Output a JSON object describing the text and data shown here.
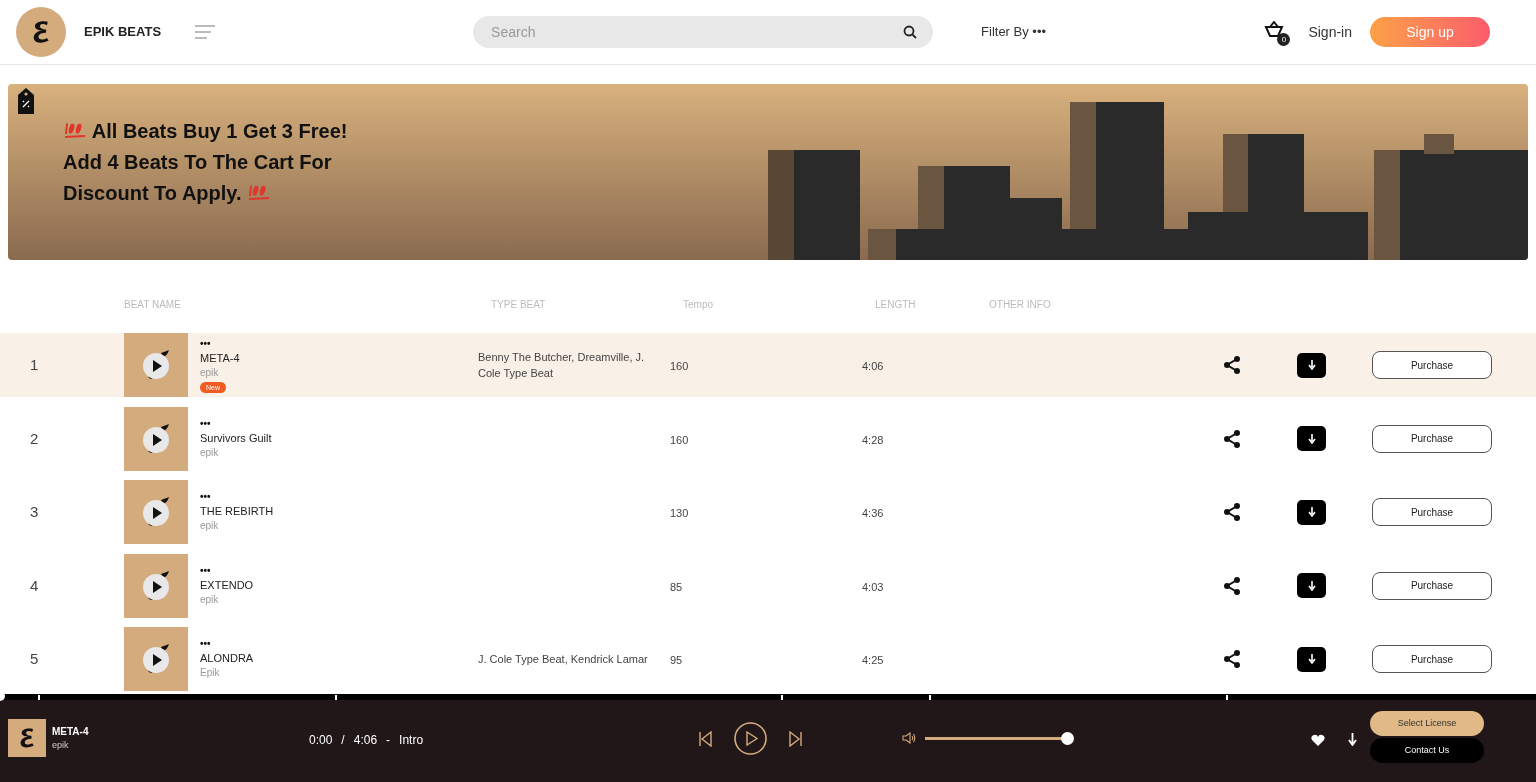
{
  "header": {
    "brand": "EPIK BEATS",
    "search": {
      "placeholder": "Search"
    },
    "filter": "Filter By •••",
    "cart_count": "0",
    "sign_in": "Sign-in",
    "sign_up": "Sign up"
  },
  "banner": {
    "lines": [
      "All Beats Buy 1 Get 3 Free!",
      "Add 4 Beats To The Cart For",
      "Discount To Apply."
    ]
  },
  "table": {
    "columns": [
      "BEAT NAME",
      "TYPE BEAT",
      "Tempo",
      "LENGTH",
      "OTHER INFO"
    ],
    "rows": [
      {
        "number": "1",
        "menu": "•••",
        "title": "META-4",
        "artist": "epik",
        "badge": "New",
        "type_beat": "Benny The Butcher, Dreamville, J. Cole Type Beat",
        "tempo": "160",
        "length": "4:06",
        "action": "Purchase",
        "selected": true
      },
      {
        "number": "2",
        "menu": "•••",
        "title": "Survivors Guilt",
        "artist": "epik",
        "tempo": "160",
        "length": "4:28",
        "action": "Purchase",
        "selected": false
      },
      {
        "number": "3",
        "menu": "•••",
        "title": "THE REBIRTH",
        "artist": "epik",
        "tempo": "130",
        "length": "4:36",
        "action": "Purchase",
        "selected": false
      },
      {
        "number": "4",
        "menu": "•••",
        "title": "EXTENDO",
        "artist": "epik",
        "tempo": "85",
        "length": "4:03",
        "action": "Purchase",
        "selected": false
      },
      {
        "number": "5",
        "menu": "•••",
        "title": "ALONDRA",
        "artist": "Epik",
        "type_beat": "J. Cole Type Beat, Kendrick Lamar",
        "tempo": "95",
        "length": "4:25",
        "action": "Purchase",
        "selected": false
      }
    ]
  },
  "player": {
    "progress": {
      "level": 0
    },
    "title": "META-4",
    "artist": "epik",
    "elapsed": "0:00",
    "separator": "/",
    "duration": "4:06",
    "dash": "-",
    "section": "Intro",
    "volume": {
      "level": 1
    },
    "select_license": "Select License",
    "contact": "Contact Us"
  }
}
